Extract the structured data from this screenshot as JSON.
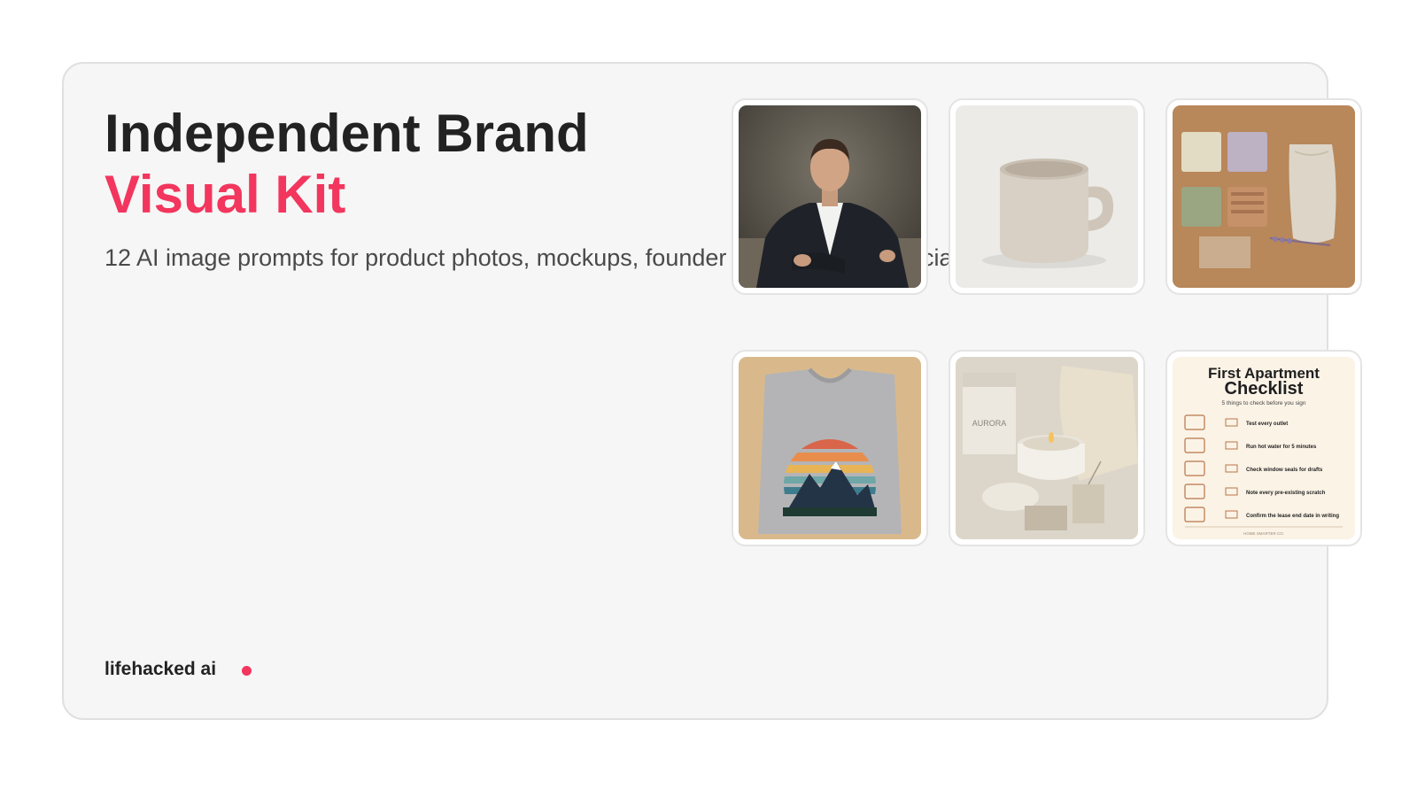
{
  "hero": {
    "title_line1": "Independent Brand",
    "title_line2": "Visual Kit",
    "subtitle": "12 AI image prompts for product photos, mockups, founder headshots and social"
  },
  "footer": {
    "brand": "lifehacked ai"
  },
  "colors": {
    "accent": "#f2365e",
    "card_bg": "#f6f6f6",
    "title": "#222222"
  },
  "tiles": [
    {
      "image": "founder-headshot"
    },
    {
      "image": "ceramic-mug"
    },
    {
      "image": "soap-flatlay"
    },
    {
      "image": "mountain-tshirt"
    },
    {
      "image": "candle-packaging",
      "brand_text": "AURORA"
    },
    {
      "image": "checklist-poster",
      "title_line1": "First Apartment",
      "title_line2": "Checklist",
      "subtitle": "5 things to check before you sign",
      "items": [
        "Test every outlet",
        "Run hot water for 5 minutes",
        "Check window seals for drafts",
        "Note every pre-existing scratch",
        "Confirm the lease end date in writing"
      ],
      "footer": "HOME SMARTER CO."
    }
  ]
}
